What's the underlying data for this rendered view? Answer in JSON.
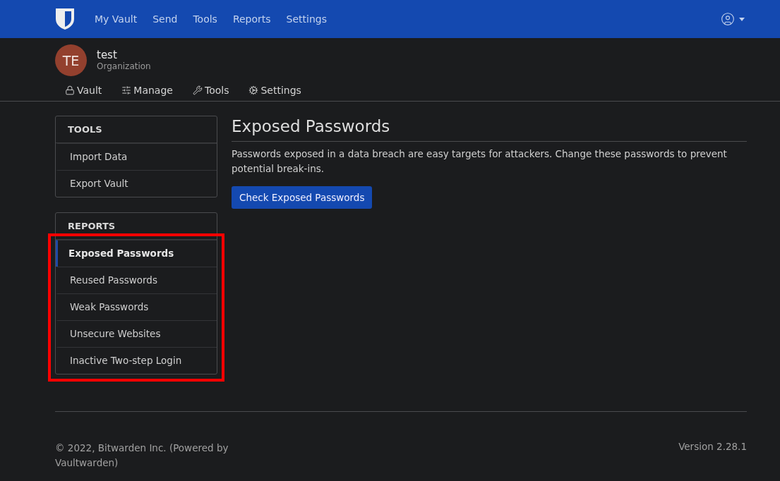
{
  "top_nav": {
    "items": [
      {
        "label": "My Vault"
      },
      {
        "label": "Send"
      },
      {
        "label": "Tools"
      },
      {
        "label": "Reports"
      },
      {
        "label": "Settings"
      }
    ]
  },
  "organization": {
    "initials": "TE",
    "name": "test",
    "type": "Organization"
  },
  "org_tabs": [
    {
      "kind": "lock",
      "label": "Vault"
    },
    {
      "kind": "sliders",
      "label": "Manage"
    },
    {
      "kind": "wrench",
      "label": "Tools"
    },
    {
      "kind": "cogs",
      "label": "Settings"
    }
  ],
  "sidebar": {
    "sections": [
      {
        "title": "TOOLS",
        "highlighted": false,
        "items": [
          {
            "label": "Import Data",
            "selected": false
          },
          {
            "label": "Export Vault",
            "selected": false
          }
        ]
      },
      {
        "title": "REPORTS",
        "highlighted": true,
        "items": [
          {
            "label": "Exposed Passwords",
            "selected": true
          },
          {
            "label": "Reused Passwords",
            "selected": false
          },
          {
            "label": "Weak Passwords",
            "selected": false
          },
          {
            "label": "Unsecure Websites",
            "selected": false
          },
          {
            "label": "Inactive Two-step Login",
            "selected": false
          }
        ]
      }
    ]
  },
  "main": {
    "title": "Exposed Passwords",
    "description": "Passwords exposed in a data breach are easy targets for attackers. Change these passwords to prevent potential break-ins.",
    "button": "Check Exposed Passwords"
  },
  "footer": {
    "copyright": "© 2022, Bitwarden Inc. (Powered by Vaultwarden)",
    "version": "Version 2.28.1"
  }
}
